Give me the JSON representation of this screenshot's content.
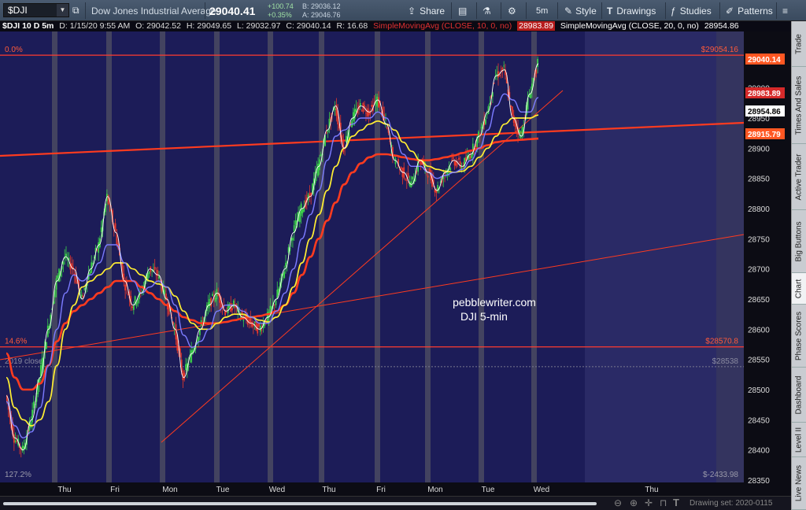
{
  "toolbar": {
    "symbol": "$DJI",
    "description": "Dow Jones Industrial Average",
    "last_price": "29040.41",
    "net_change": "+100.74",
    "pct_change": "+0.35%",
    "bid": "B: 29036.12",
    "ask": "A: 29046.76",
    "share_label": "Share",
    "timeframe_label": "5m",
    "style_label": "Style",
    "drawings_label": "Drawings",
    "studies_label": "Studies",
    "patterns_label": "Patterns"
  },
  "header": {
    "title": "$DJI 10 D 5m",
    "date": "D: 1/15/20 9:55 AM",
    "open": "O: 29042.52",
    "high": "H: 29049.65",
    "low": "L: 29032.97",
    "close": "C: 29040.14",
    "range": "R: 16.68",
    "study1": "SimpleMovingAvg (CLOSE, 10, 0, no)",
    "study1_value": "28983.89",
    "study2": "SimpleMovingAvg (CLOSE, 20, 0, no)",
    "study2_value": "28954.86"
  },
  "sidebar": {
    "tabs": [
      "Trade",
      "Times And Sales",
      "Active Trader",
      "Big Buttons",
      "Chart",
      "Phase Scores",
      "Dashboard",
      "Level II",
      "Live News"
    ],
    "active": "Chart"
  },
  "bottom": {
    "drawing_set": "Drawing set: 2020-0115"
  },
  "chart_data": {
    "type": "candlestick",
    "title": "$DJI 10 D 5m",
    "y_axis_ticks": [
      29050,
      29000,
      28950,
      28900,
      28850,
      28800,
      28750,
      28700,
      28650,
      28600,
      28550,
      28500,
      28450,
      28400,
      28350
    ],
    "ylim": [
      28350,
      29070
    ],
    "x_axis_labels": [
      "Thu",
      "Fri",
      "Mon",
      "Tue",
      "Wed",
      "Thu",
      "Fri",
      "Mon",
      "Tue",
      "Wed",
      "Thu"
    ],
    "price_labels": [
      {
        "text": "29040.14",
        "color": "#ff5722",
        "kind": "last"
      },
      {
        "text": "28983.89",
        "color": "#d62a2a",
        "kind": "sma10"
      },
      {
        "text": "28954.86",
        "color": "#ffffff",
        "kind": "sma20"
      },
      {
        "text": "28915.79",
        "color": "#ff5722",
        "kind": "trendline"
      }
    ],
    "fib_levels": [
      {
        "label_left": "0.0%",
        "label_right": "$29054.16",
        "value": 29054.16,
        "color": "#ff3b2f"
      },
      {
        "label_left": "14.6%",
        "label_right": "$28570.8",
        "value": 28570.8,
        "color": "#ff3b2f"
      },
      {
        "label_left": "127.2%",
        "label_right": "$-2433.98",
        "value": 28350,
        "color": "#888888"
      }
    ],
    "reference_lines": [
      {
        "label_left": "2019 close",
        "label_right": "$28538",
        "value": 28538,
        "color": "#7a7a90"
      }
    ],
    "watermark": [
      "pebblewriter.com",
      "DJI 5-min"
    ],
    "close_series": [
      28490,
      28420,
      28400,
      28450,
      28520,
      28600,
      28680,
      28720,
      28700,
      28650,
      28700,
      28740,
      28820,
      28760,
      28680,
      28640,
      28660,
      28700,
      28690,
      28650,
      28600,
      28520,
      28560,
      28600,
      28640,
      28660,
      28630,
      28640,
      28620,
      28610,
      28600,
      28620,
      28650,
      28700,
      28760,
      28800,
      28820,
      28870,
      28930,
      28970,
      28900,
      28950,
      28970,
      28960,
      28980,
      28940,
      28880,
      28860,
      28840,
      28880,
      28860,
      28830,
      28860,
      28880,
      28870,
      28890,
      28920,
      28960,
      29020,
      29030,
      28950,
      28920,
      28990,
      29040
    ],
    "sma10_series": [
      28480,
      28440,
      28420,
      28430,
      28470,
      28540,
      28600,
      28660,
      28690,
      28680,
      28690,
      28710,
      28740,
      28740,
      28710,
      28680,
      28660,
      28670,
      28680,
      28670,
      28640,
      28590,
      28570,
      28580,
      28600,
      28630,
      28640,
      28640,
      28630,
      28620,
      28610,
      28610,
      28630,
      28660,
      28700,
      28750,
      28790,
      28830,
      28880,
      28920,
      28930,
      28940,
      28950,
      28950,
      28960,
      28950,
      28920,
      28890,
      28870,
      28870,
      28860,
      28850,
      28855,
      28860,
      28865,
      28880,
      28900,
      28930,
      28970,
      28990,
      28980,
      28960,
      28960,
      28984
    ],
    "sma20_series": [
      28520,
      28470,
      28450,
      28440,
      28450,
      28480,
      28540,
      28600,
      28640,
      28670,
      28680,
      28690,
      28700,
      28710,
      28710,
      28700,
      28690,
      28680,
      28675,
      28670,
      28655,
      28630,
      28610,
      28600,
      28600,
      28610,
      28620,
      28625,
      28625,
      28620,
      28615,
      28612,
      28620,
      28640,
      28670,
      28710,
      28750,
      28790,
      28830,
      28870,
      28900,
      28920,
      28930,
      28940,
      28945,
      28940,
      28930,
      28910,
      28895,
      28880,
      28870,
      28865,
      28862,
      28860,
      28862,
      28870,
      28885,
      28900,
      28920,
      28940,
      28950,
      28950,
      28950,
      28955
    ],
    "sma50_series": [
      28560,
      28520,
      28500,
      28500,
      28510,
      28540,
      28580,
      28610,
      28630,
      28640,
      28650,
      28660,
      28670,
      28680,
      28680,
      28680,
      28670,
      28660,
      28650,
      28640,
      28630,
      28620,
      28615,
      28610,
      28610,
      28610,
      28612,
      28615,
      28618,
      28620,
      28622,
      28625,
      28630,
      28640,
      28660,
      28690,
      28720,
      28750,
      28780,
      28810,
      28840,
      28860,
      28875,
      28885,
      28890,
      28890,
      28888,
      28885,
      28882,
      28880,
      28880,
      28882,
      28885,
      28888,
      28892,
      28896,
      28900,
      28905,
      28910,
      28912,
      28913,
      28914,
      28915,
      28916
    ]
  }
}
